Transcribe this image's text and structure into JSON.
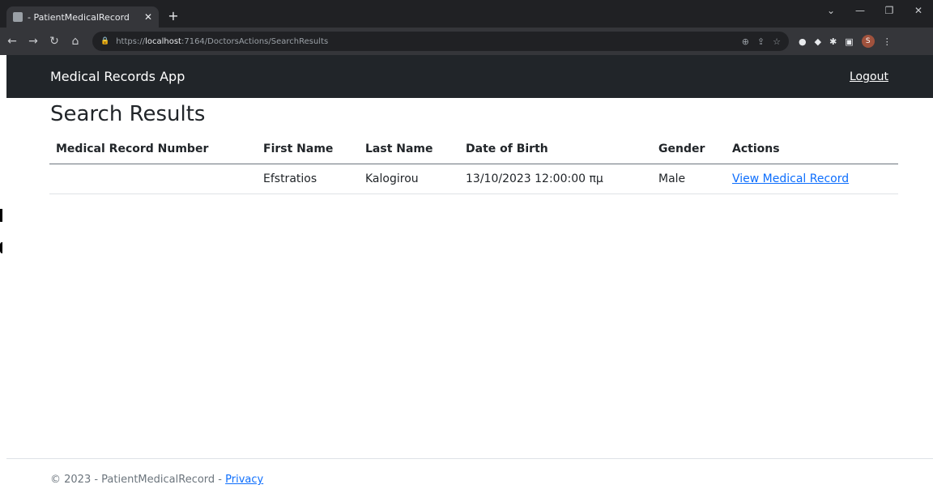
{
  "browser": {
    "tab_title": "- PatientMedicalRecord",
    "new_tab_glyph": "+",
    "url_prefix": "https://",
    "url_host": "localhost",
    "url_rest": ":7164/DoctorsActions/SearchResults",
    "profile_initial": "S"
  },
  "navbar": {
    "brand": "Medical Records App",
    "logout": "Logout"
  },
  "main": {
    "title": "Search Results",
    "table": {
      "headers": [
        "Medical Record Number",
        "First Name",
        "Last Name",
        "Date of Birth",
        "Gender",
        "Actions"
      ],
      "rows": [
        {
          "medical_record_number": "",
          "first_name": "Efstratios",
          "last_name": "Kalogirou",
          "date_of_birth": "13/10/2023 12:00:00 πμ",
          "gender": "Male",
          "action": "View Medical Record"
        }
      ]
    }
  },
  "footer": {
    "copyright": "© 2023 - PatientMedicalRecord - ",
    "privacy": "Privacy"
  },
  "colors": {
    "navbar_bg": "#212529",
    "link": "#0d6efd",
    "chrome_dark": "#202124"
  }
}
